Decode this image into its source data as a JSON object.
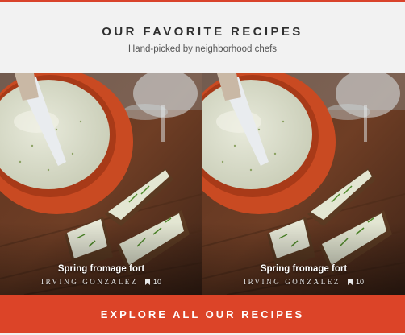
{
  "header": {
    "title": "OUR FAVORITE RECIPES",
    "subtitle": "Hand-picked by neighborhood chefs"
  },
  "recipes": [
    {
      "name": "Spring fromage fort",
      "author": "IRVING GONZALEZ",
      "bookmark_icon": "bookmark-icon",
      "bookmarks": "10"
    },
    {
      "name": "Spring fromage fort",
      "author": "IRVING GONZALEZ",
      "bookmark_icon": "bookmark-icon",
      "bookmarks": "10"
    }
  ],
  "cta": {
    "label": "EXPLORE ALL OUR RECIPES"
  },
  "colors": {
    "accent": "#dc4428",
    "header_bg": "#f2f2f2",
    "title": "#2f2f2f"
  }
}
